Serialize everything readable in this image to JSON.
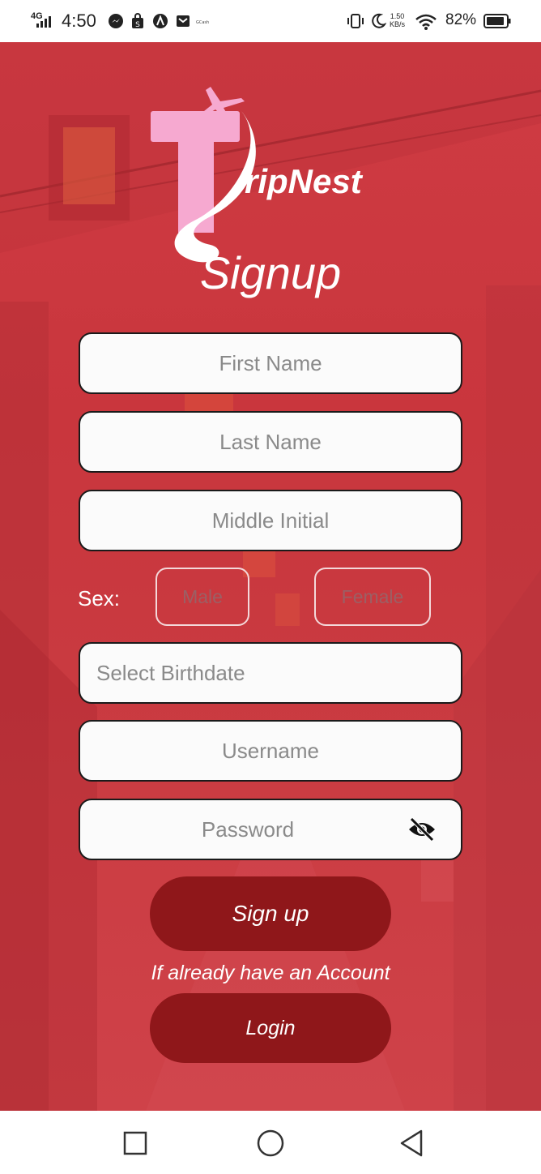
{
  "status_bar": {
    "network": "4G",
    "time": "4:50",
    "speed_value": "1.50",
    "speed_unit": "KB/s",
    "battery": "82%",
    "icons": [
      "messenger-icon",
      "shopping-bag-icon",
      "app-a-icon",
      "mail-icon",
      "gcash-icon",
      "vibrate-icon",
      "moon-icon",
      "wifi-icon",
      "battery-icon"
    ]
  },
  "app": {
    "brand": "ripNest",
    "title": "Signup",
    "colors": {
      "background": "#cf3b43",
      "button": "#8f171a",
      "field": "#fbfbfb",
      "logo_pink": "#f6a9d0"
    }
  },
  "form": {
    "first_name": {
      "placeholder": "First Name",
      "value": ""
    },
    "last_name": {
      "placeholder": "Last Name",
      "value": ""
    },
    "middle_initial": {
      "placeholder": "Middle Initial",
      "value": ""
    },
    "sex": {
      "label": "Sex:",
      "options": [
        "Male",
        "Female"
      ]
    },
    "birthdate": {
      "placeholder": "Select Birthdate"
    },
    "username": {
      "placeholder": "Username",
      "value": ""
    },
    "password": {
      "placeholder": "Password",
      "value": "",
      "toggle_icon": "eye-off-icon"
    }
  },
  "actions": {
    "signup_label": "Sign up",
    "helper_text": "If already have an Account",
    "login_label": "Login"
  },
  "nav_bar": {
    "buttons": [
      "recents-square-icon",
      "home-circle-icon",
      "back-triangle-icon"
    ]
  }
}
